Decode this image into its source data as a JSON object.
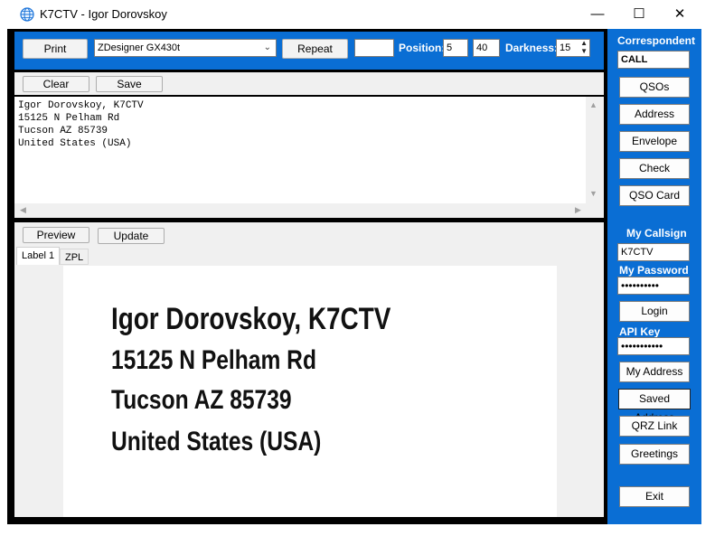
{
  "window": {
    "title": "K7CTV - Igor Dorovskoy",
    "minimize_glyph": "—",
    "maximize_glyph": "☐",
    "close_glyph": "✕"
  },
  "toolbar": {
    "print_label": "Print",
    "printer_selected": "ZDesigner GX430t",
    "repeat_label": "Repeat",
    "repeat_value": "",
    "position_label": "Position:",
    "position_x": "5",
    "position_y": "40",
    "darkness_label": "Darkness:",
    "darkness_value": "15"
  },
  "editor": {
    "clear_label": "Clear",
    "save_label": "Save",
    "text": "Igor Dorovskoy, K7CTV\n15125 N Pelham Rd\nTucson AZ 85739\nUnited States (USA)"
  },
  "preview": {
    "preview_label": "Preview",
    "update_label": "Update",
    "tabs": [
      "Label 1",
      "ZPL"
    ],
    "lines": [
      "Igor Dorovskoy, K7CTV",
      "15125 N Pelham Rd",
      "Tucson AZ 85739",
      "United States (USA)"
    ]
  },
  "sidebar": {
    "correspondent_heading": "Correspondent",
    "call_value": "CALL",
    "buttons_top": [
      "QSOs",
      "Address",
      "Envelope",
      "Check",
      "QSO Card"
    ],
    "my_callsign_heading": "My Callsign",
    "my_callsign_value": "K7CTV",
    "my_password_heading": "My Password",
    "password_mask": "••••••••••",
    "login_label": "Login",
    "api_key_heading": "API Key",
    "api_key_mask": "•••••••••••",
    "buttons_bottom": [
      "My Address",
      "Saved Address",
      "QRZ Link",
      "Greetings"
    ],
    "exit_label": "Exit"
  },
  "colors": {
    "accent": "#0a6ed4",
    "frame": "#000000",
    "panel": "#f0f0f0"
  }
}
